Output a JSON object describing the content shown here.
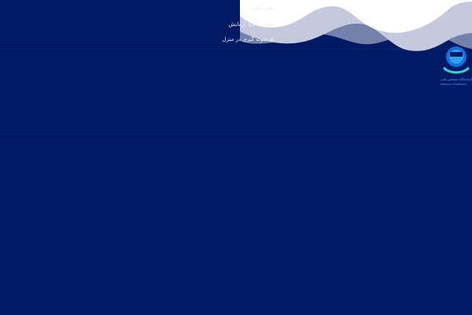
{
  "menu": {
    "items": [
      {
        "label": "دهی آنلاین",
        "icon": ""
      },
      {
        "label": "جواب پاسخ آزمایش",
        "icon": ""
      },
      {
        "label": "نمونه گیری در منزل",
        "icon": "home-icon"
      }
    ]
  },
  "logo": {
    "name": "آزمایشگاه تشخیص طبی",
    "subtitle": "MEDICAL DIAGNOSTIC"
  },
  "colors": {
    "background": "#001a66",
    "wave_light": "#ffffff",
    "wave_mid": "#c4c9de",
    "wave_dark": "#8a93b8",
    "logo_accent": "#3fa9f5"
  }
}
